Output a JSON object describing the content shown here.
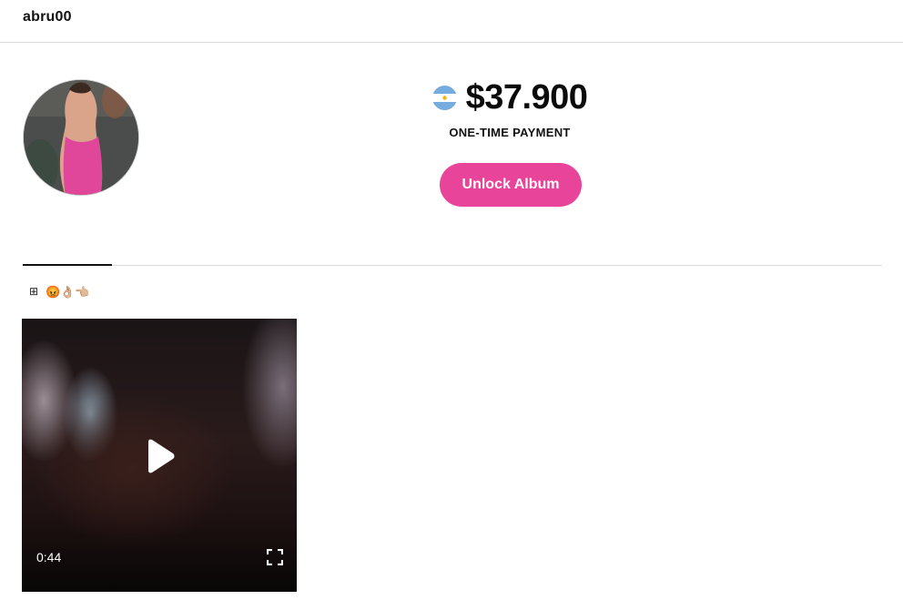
{
  "header": {
    "username": "abru00"
  },
  "profile": {
    "avatar_icon": "profile-photo",
    "flag_icon": "argentina-flag-icon"
  },
  "pricing": {
    "price": "$37.900",
    "payment_type": "ONE-TIME PAYMENT",
    "unlock_label": "Unlock Album"
  },
  "album": {
    "grid_icon": "⊞",
    "label": "😡👌🏼👈🏼"
  },
  "video": {
    "duration": "0:44"
  },
  "colors": {
    "accent": "#e8449a",
    "text": "#111111",
    "divider": "#d9d9d9"
  }
}
